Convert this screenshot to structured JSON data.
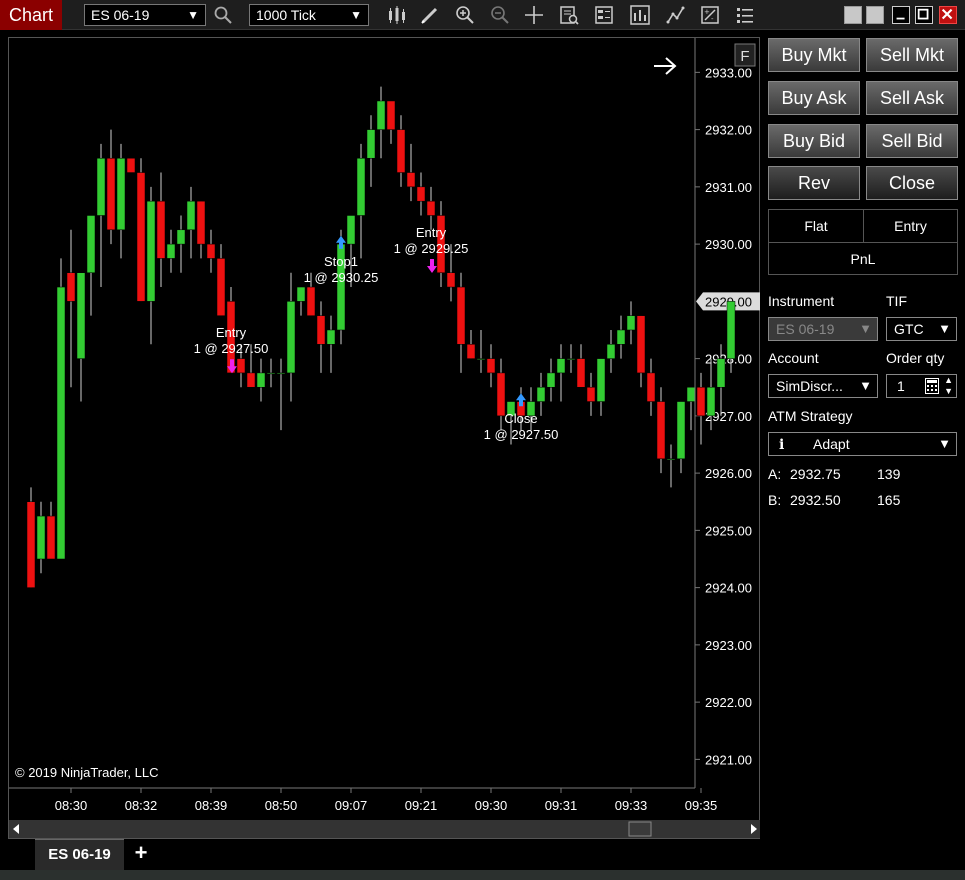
{
  "window": {
    "title": "Chart",
    "instrument": "ES 06-19",
    "interval": "1000 Tick"
  },
  "colors": {
    "up": "#33cc33",
    "down": "#ee1111",
    "title_bg": "#8b0000",
    "buy_marker": "#3399ff",
    "sell_marker": "#ee22ee"
  },
  "toolbar_icons": [
    "search-icon",
    "bar-style-icon",
    "drawing-pencil-icon",
    "zoom-in-icon",
    "zoom-out-icon",
    "crosshair-icon",
    "data-box-icon",
    "properties-icon",
    "indicators-icon",
    "strategies-icon",
    "templates-icon",
    "chart-trader-icon"
  ],
  "chart": {
    "ylim": [
      2920.5,
      2933.6
    ],
    "yticks": [
      "2933.00",
      "2932.00",
      "2931.00",
      "2930.00",
      "2928.00",
      "2927.00",
      "2926.00",
      "2925.00",
      "2924.00",
      "2923.00",
      "2922.00",
      "2921.00"
    ],
    "ytick_values": [
      2933,
      2932,
      2931,
      2930,
      2928,
      2927,
      2926,
      2925,
      2924,
      2923,
      2922,
      2921
    ],
    "last_price": "2929.00",
    "last_price_value": 2929,
    "xticks": [
      "08:30",
      "08:32",
      "08:39",
      "08:50",
      "09:07",
      "09:21",
      "09:30",
      "09:31",
      "09:33",
      "09:35"
    ],
    "xtick_bars": [
      4,
      11,
      18,
      25,
      32,
      39,
      46,
      53,
      60,
      67
    ],
    "copyright": "© 2019 NinjaTrader, LLC",
    "f_button": "F"
  },
  "chart_data": {
    "type": "candlestick",
    "bars": [
      [
        2925.5,
        2925.75,
        2924.0,
        2924.0
      ],
      [
        2924.5,
        2925.5,
        2924.25,
        2925.25
      ],
      [
        2925.25,
        2925.5,
        2924.5,
        2924.5
      ],
      [
        2924.5,
        2929.75,
        2924.5,
        2929.25
      ],
      [
        2929.5,
        2930.25,
        2927.5,
        2929.0
      ],
      [
        2928.0,
        2929.5,
        2927.25,
        2929.5
      ],
      [
        2929.5,
        2930.5,
        2928.75,
        2930.5
      ],
      [
        2930.5,
        2931.75,
        2929.25,
        2931.5
      ],
      [
        2931.5,
        2932.0,
        2930.0,
        2930.25
      ],
      [
        2930.25,
        2931.75,
        2929.75,
        2931.5
      ],
      [
        2931.5,
        2931.25,
        2931.25,
        2931.25
      ],
      [
        2931.25,
        2931.5,
        2929.25,
        2929.0
      ],
      [
        2929.0,
        2931.0,
        2928.25,
        2930.75
      ],
      [
        2930.75,
        2931.25,
        2929.25,
        2929.75
      ],
      [
        2929.75,
        2930.25,
        2929.5,
        2930.0
      ],
      [
        2930.0,
        2930.5,
        2929.5,
        2930.25
      ],
      [
        2930.25,
        2931.0,
        2929.75,
        2930.75
      ],
      [
        2930.75,
        2930.75,
        2929.75,
        2930.0
      ],
      [
        2930.0,
        2930.25,
        2929.5,
        2929.75
      ],
      [
        2929.75,
        2930.0,
        2929.0,
        2928.75
      ],
      [
        2929.0,
        2929.25,
        2927.75,
        2927.75
      ],
      [
        2928.0,
        2928.25,
        2927.5,
        2927.75
      ],
      [
        2927.75,
        2928.25,
        2927.5,
        2927.5
      ],
      [
        2927.5,
        2928.0,
        2927.25,
        2927.75
      ],
      [
        2927.75,
        2928.0,
        2927.5,
        2927.75
      ],
      [
        2927.75,
        2928.0,
        2926.75,
        2927.75
      ],
      [
        2927.75,
        2929.5,
        2927.25,
        2929.0
      ],
      [
        2929.0,
        2929.25,
        2928.75,
        2929.25
      ],
      [
        2929.25,
        2929.5,
        2928.75,
        2928.75
      ],
      [
        2928.75,
        2929.0,
        2927.75,
        2928.25
      ],
      [
        2928.25,
        2928.75,
        2927.75,
        2928.5
      ],
      [
        2928.5,
        2930.25,
        2928.25,
        2930.0
      ],
      [
        2930.0,
        2930.5,
        2929.25,
        2930.5
      ],
      [
        2930.5,
        2931.75,
        2929.75,
        2931.5
      ],
      [
        2931.5,
        2932.25,
        2931.0,
        2932.0
      ],
      [
        2932.0,
        2932.75,
        2931.5,
        2932.5
      ],
      [
        2932.5,
        2932.5,
        2931.75,
        2932.0
      ],
      [
        2932.0,
        2932.25,
        2931.0,
        2931.25
      ],
      [
        2931.25,
        2931.75,
        2930.75,
        2931.0
      ],
      [
        2931.0,
        2931.25,
        2930.5,
        2930.75
      ],
      [
        2930.75,
        2931.0,
        2930.25,
        2930.5
      ],
      [
        2930.5,
        2930.75,
        2929.25,
        2929.5
      ],
      [
        2929.5,
        2930.0,
        2929.0,
        2929.25
      ],
      [
        2929.25,
        2929.5,
        2927.75,
        2928.25
      ],
      [
        2928.25,
        2928.5,
        2928.0,
        2928.0
      ],
      [
        2928.0,
        2928.5,
        2927.75,
        2928.0
      ],
      [
        2928.0,
        2928.25,
        2927.5,
        2927.75
      ],
      [
        2927.75,
        2928.0,
        2926.75,
        2927.0
      ],
      [
        2927.0,
        2927.25,
        2926.5,
        2927.25
      ],
      [
        2927.25,
        2927.5,
        2926.75,
        2927.0
      ],
      [
        2927.0,
        2927.5,
        2926.75,
        2927.25
      ],
      [
        2927.25,
        2927.75,
        2927.0,
        2927.5
      ],
      [
        2927.5,
        2928.0,
        2927.25,
        2927.75
      ],
      [
        2927.75,
        2928.25,
        2927.25,
        2928.0
      ],
      [
        2928.0,
        2928.25,
        2927.75,
        2928.0
      ],
      [
        2928.0,
        2928.25,
        2927.5,
        2927.5
      ],
      [
        2927.5,
        2927.75,
        2927.0,
        2927.25
      ],
      [
        2927.25,
        2928.0,
        2927.0,
        2928.0
      ],
      [
        2928.0,
        2928.5,
        2927.75,
        2928.25
      ],
      [
        2928.25,
        2928.75,
        2928.0,
        2928.5
      ],
      [
        2928.5,
        2929.0,
        2928.25,
        2928.75
      ],
      [
        2928.75,
        2928.75,
        2927.5,
        2927.75
      ],
      [
        2927.75,
        2928.0,
        2927.0,
        2927.25
      ],
      [
        2927.25,
        2927.5,
        2926.0,
        2926.25
      ],
      [
        2926.25,
        2926.5,
        2925.75,
        2926.25
      ],
      [
        2926.25,
        2927.25,
        2926.0,
        2927.25
      ],
      [
        2927.25,
        2927.5,
        2926.75,
        2927.5
      ],
      [
        2927.5,
        2927.75,
        2926.5,
        2927.0
      ],
      [
        2927.0,
        2928.0,
        2926.75,
        2927.5
      ],
      [
        2927.5,
        2928.25,
        2927.0,
        2928.0
      ],
      [
        2928.0,
        2929.0,
        2927.75,
        2929.0
      ]
    ],
    "trades": [
      {
        "bar": 20,
        "label": "Entry",
        "sub": "1 @ 2927.50",
        "side": "sell",
        "price": 2927.5
      },
      {
        "bar": 31,
        "label": "Stop1",
        "sub": "1 @ 2930.25",
        "side": "buy",
        "price": 2930.25
      },
      {
        "bar": 40,
        "label": "Entry",
        "sub": "1 @ 2929.25",
        "side": "sell",
        "price": 2929.25
      },
      {
        "bar": 49,
        "label": "Close",
        "sub": "1 @ 2927.50",
        "side": "buy",
        "price": 2927.5
      }
    ]
  },
  "trade_panel": {
    "buy_mkt": "Buy Mkt",
    "sell_mkt": "Sell Mkt",
    "buy_ask": "Buy Ask",
    "sell_ask": "Sell Ask",
    "buy_bid": "Buy Bid",
    "sell_bid": "Sell Bid",
    "rev": "Rev",
    "close": "Close",
    "flat": "Flat",
    "entry": "Entry",
    "pnl": "PnL",
    "instrument_label": "Instrument",
    "instrument_value": "ES 06-19",
    "tif_label": "TIF",
    "tif_value": "GTC",
    "account_label": "Account",
    "account_value": "SimDiscr...",
    "order_qty_label": "Order qty",
    "order_qty_value": "1",
    "atm_label": "ATM Strategy",
    "atm_value": "Adapt",
    "ask_label": "A:",
    "ask_price": "2932.75",
    "ask_size": "139",
    "bid_label": "B:",
    "bid_price": "2932.50",
    "bid_size": "165"
  },
  "tabs": {
    "active": "ES 06-19",
    "add": "+"
  }
}
